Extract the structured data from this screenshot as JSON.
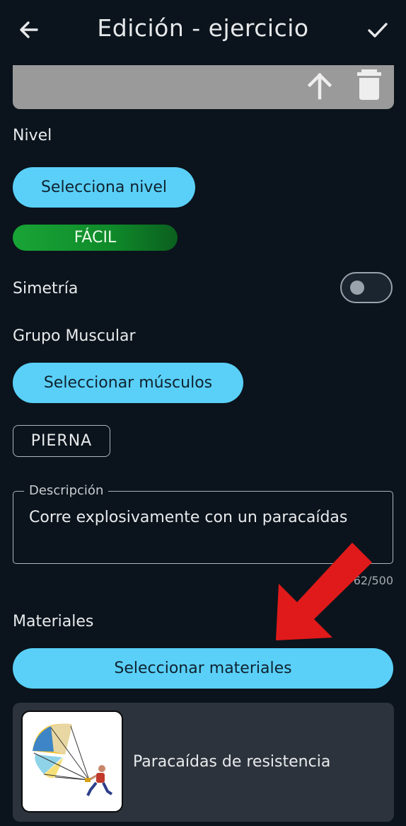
{
  "header": {
    "title": "Edición - ejercicio"
  },
  "nivel": {
    "label": "Nivel",
    "button": "Selecciona nivel",
    "selected": "FÁCIL"
  },
  "simetria": {
    "label": "Simetría",
    "enabled": false
  },
  "grupo": {
    "label": "Grupo Muscular",
    "button": "Seleccionar músculos",
    "chip": "PIERNA"
  },
  "descripcion": {
    "legend": "Descripción",
    "value": "Corre explosivamente con un paracaídas",
    "counter": "62/500"
  },
  "materiales": {
    "label": "Materiales",
    "button": "Seleccionar materiales",
    "items": [
      {
        "name": "Paracaídas de resistencia"
      }
    ]
  },
  "colors": {
    "background": "#0b141c",
    "accent": "#5ad0f8",
    "level_green": "#19a436",
    "annotation_arrow": "#e01a1a"
  }
}
